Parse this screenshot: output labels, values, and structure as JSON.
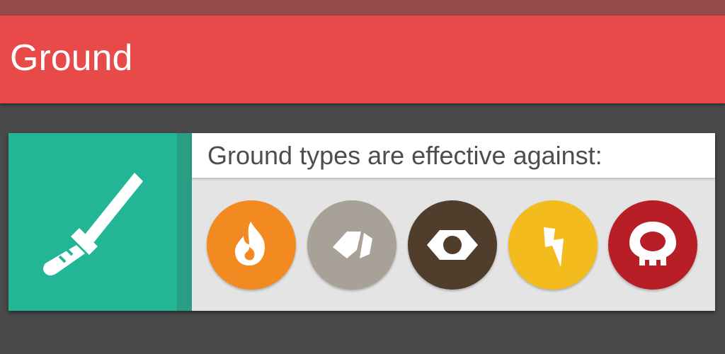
{
  "app_bar": {
    "title": "Ground"
  },
  "card": {
    "heading": "Ground types are effective against:",
    "move_icon": "sword-icon",
    "types": [
      {
        "name": "fire",
        "icon": "fire-icon",
        "color": "#f38a21"
      },
      {
        "name": "rock",
        "icon": "rock-icon",
        "color": "#a7a197"
      },
      {
        "name": "steel",
        "icon": "steel-nut-icon",
        "color": "#513d2b"
      },
      {
        "name": "electric",
        "icon": "lightning-icon",
        "color": "#f4bb1e"
      },
      {
        "name": "poison",
        "icon": "skull-icon",
        "color": "#b81e26"
      }
    ]
  },
  "colors": {
    "app_bar": "#e84a4a",
    "status_bar": "#974a4a",
    "background": "#4a4a4a",
    "move_panel": "#22b697"
  }
}
